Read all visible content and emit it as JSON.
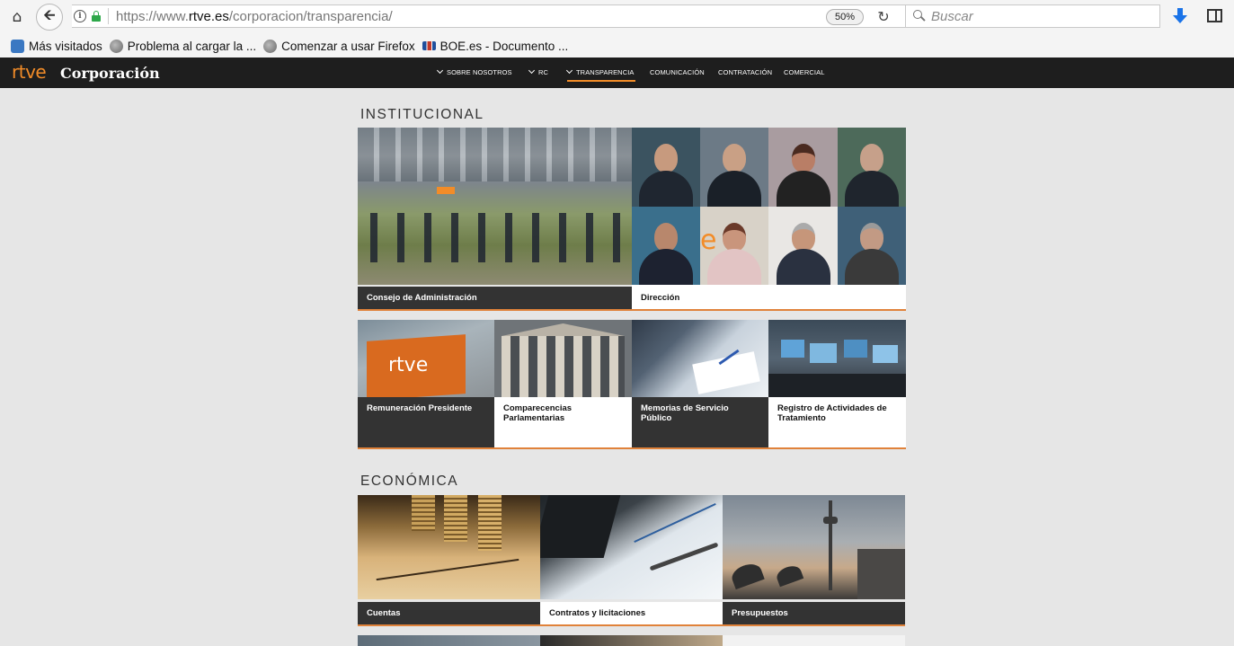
{
  "browser": {
    "url_prefix": "https://www.",
    "url_domain": "rtve.es",
    "url_path": "/corporacion/transparencia/",
    "zoom": "50%",
    "search_placeholder": "Buscar",
    "bookmarks": [
      {
        "label": "Más visitados",
        "icon": "star"
      },
      {
        "label": "Problema al cargar la ...",
        "icon": "globe"
      },
      {
        "label": "Comenzar a usar Firefox",
        "icon": "globe"
      },
      {
        "label": "BOE.es - Documento ...",
        "icon": "boe"
      }
    ]
  },
  "site": {
    "logo": "rtve",
    "brand": "Corporación",
    "nav": [
      {
        "label": "SOBRE NOSOTROS",
        "dropdown": true
      },
      {
        "label": "RC",
        "dropdown": true
      },
      {
        "label": "TRANSPARENCIA",
        "dropdown": true,
        "active": true
      },
      {
        "label": "COMUNICACIÓN",
        "dropdown": false
      },
      {
        "label": "CONTRATACIÓN",
        "dropdown": false
      },
      {
        "label": "COMERCIAL",
        "dropdown": false
      }
    ],
    "accent_color": "#f28c28"
  },
  "sections": {
    "institucional": {
      "title": "INSTITUCIONAL",
      "tiles": [
        {
          "label": "Consejo de Administración"
        },
        {
          "label": "Dirección"
        },
        {
          "label": "Remuneración Presidente"
        },
        {
          "label": "Comparecencias Parlamentarias"
        },
        {
          "label": "Memorias de Servicio Público"
        },
        {
          "label": "Registro de Actividades de Tratamiento"
        }
      ]
    },
    "economica": {
      "title": "ECONÓMICA",
      "tiles": [
        {
          "label": "Cuentas"
        },
        {
          "label": "Contratos y licitaciones"
        },
        {
          "label": "Presupuestos"
        }
      ]
    }
  }
}
